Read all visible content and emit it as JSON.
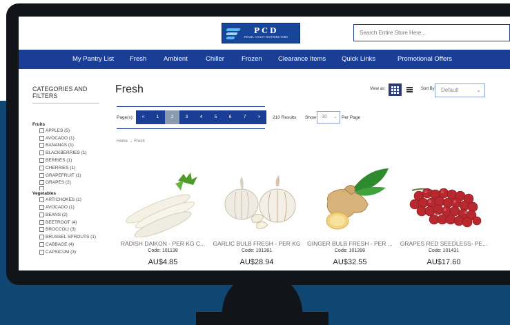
{
  "header": {
    "logo_title": "PCD",
    "logo_subtitle": "PEARL COAST DISTRIBUTORS",
    "search_placeholder": "Search Entire Store Here..."
  },
  "nav": {
    "items": [
      "My Pantry List",
      "Fresh",
      "Ambient",
      "Chiller",
      "Frozen",
      "Clearance Items",
      "Quick Links",
      "Promotional Offers"
    ]
  },
  "sidebar": {
    "title": "CATEGORIES AND FILTERS",
    "groups": [
      {
        "title": "Fruits",
        "items": [
          "APPLES (5)",
          "AVOCADO (1)",
          "BANANAS (1)",
          "BLACKBERRIES (1)",
          "BERRIES (1)",
          "CHERRIES (1)",
          "GRAPEFRUIT (1)",
          "GRAPES (2)"
        ]
      },
      {
        "title": "Vegetables",
        "items": [
          "ARTICHOKES (1)",
          "AVOCADO (1)",
          "BEANS (2)",
          "BEETROOT (4)",
          "BROCCOLI (3)",
          "BRUSSEL SPROUTS (1)",
          "CABBAGE (4)",
          "CAPSICUM (3)"
        ]
      }
    ]
  },
  "main": {
    "title": "Fresh",
    "view_as_label": "View as:",
    "sort_by_label": "Sort By",
    "sort_value": "Default",
    "pages_label": "Page(s):",
    "pager": [
      "<",
      "1",
      "2",
      "3",
      "4",
      "5",
      "6",
      "7",
      ">"
    ],
    "active_page": "2",
    "results_count": "210 Results",
    "show_label": "Show",
    "per_page_value": "30",
    "per_page_label": "Per Page",
    "breadcrumb": "Home → Fresh"
  },
  "products": [
    {
      "name": "RADISH DAIKON - PER KG C...",
      "code": "Code: 101138",
      "price": "AU$4.85",
      "icon": "daikon-radish-image"
    },
    {
      "name": "GARLIC BULB FRESH - PER KG",
      "code": "Code: 101381",
      "price": "AU$28.94",
      "icon": "garlic-image"
    },
    {
      "name": "GINGER BULB FRESH - PER ...",
      "code": "Code: 101398",
      "price": "AU$32.55",
      "icon": "ginger-image"
    },
    {
      "name": "GRAPES RED SEEDLESS- PE...",
      "code": "Code: 101431",
      "price": "AU$17.60",
      "icon": "red-grapes-image"
    }
  ],
  "colors": {
    "nav_blue": "#1a3d96",
    "background_navy": "#0f4772",
    "monitor_frame": "#111418",
    "pager_active": "#8a9bb0"
  }
}
